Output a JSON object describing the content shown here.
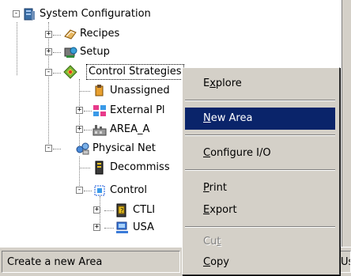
{
  "tree": {
    "root": "System Configuration",
    "recipes": "Recipes",
    "setup": "Setup",
    "control_strategies": "Control Strategies",
    "unassigned": "Unassigned",
    "external": "External Pl",
    "area_a": "AREA_A",
    "physical": "Physical Net",
    "decommissioned": "Decommiss",
    "control_network": "Control",
    "ctli": "CTLI",
    "usa": "USA"
  },
  "context_menu": {
    "items": [
      {
        "label": "Explore",
        "mnemonic": "x"
      },
      {
        "label": "New Area",
        "mnemonic": "N"
      },
      {
        "label": "Configure I/O",
        "mnemonic": "C"
      },
      {
        "label": "Print",
        "mnemonic": "P"
      },
      {
        "label": "Export",
        "mnemonic": "E"
      },
      {
        "label": "Cut",
        "mnemonic": "t"
      },
      {
        "label": "Copy",
        "mnemonic": "C"
      }
    ]
  },
  "status": {
    "message": "Create a new Area",
    "right_pane": "Use"
  },
  "colors": {
    "highlight": "#0a246a",
    "face": "#d4d0c8"
  }
}
